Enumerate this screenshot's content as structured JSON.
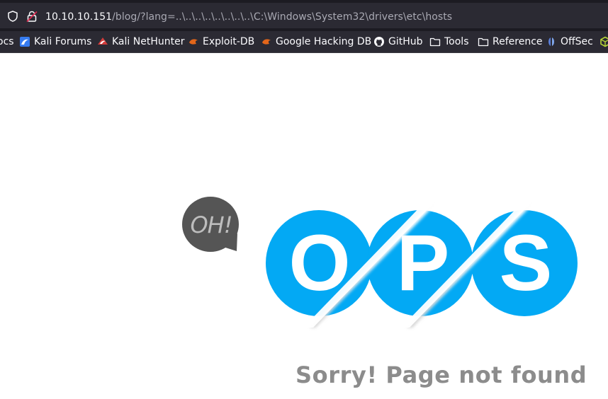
{
  "browser": {
    "url_host": "10.10.10.151",
    "url_path": "/blog/?lang=..\\..\\..\\..\\..\\..\\..\\..\\C:\\Windows\\System32\\drivers\\etc\\hosts",
    "icons": {
      "shield": "shield-icon",
      "lock": "insecure-lock-icon"
    }
  },
  "bookmarks": [
    {
      "label": "ocs",
      "icon": ""
    },
    {
      "label": "Kali Forums",
      "icon": "kali-forums-icon"
    },
    {
      "label": "Kali NetHunter",
      "icon": "kali-nethunter-icon"
    },
    {
      "label": "Exploit-DB",
      "icon": "exploit-db-icon"
    },
    {
      "label": "Google Hacking DB",
      "icon": "google-hacking-db-icon"
    },
    {
      "label": "GitHub",
      "icon": "github-icon"
    },
    {
      "label": "Tools",
      "icon": "folder-icon"
    },
    {
      "label": "Reference",
      "icon": "folder-icon"
    },
    {
      "label": "OffSec",
      "icon": "offsec-icon"
    },
    {
      "label": "",
      "icon": "cube-icon"
    }
  ],
  "page": {
    "bubble_text": "OH!",
    "letters": [
      "O",
      "P",
      "S"
    ],
    "message": "Sorry! Page not found",
    "colors": {
      "circle": "#03a9f4",
      "bubble": "#555555",
      "message": "#8c8c8c"
    }
  }
}
